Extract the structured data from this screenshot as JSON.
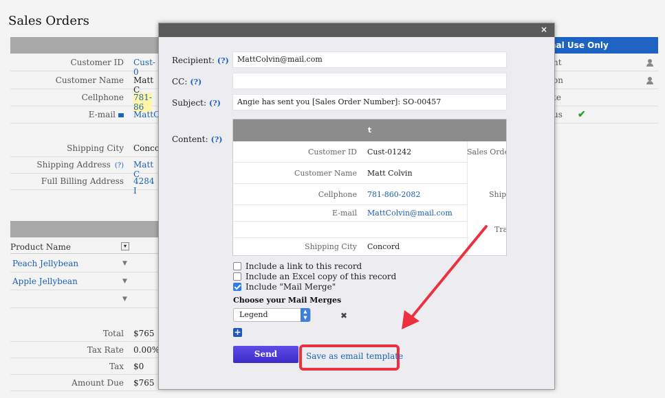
{
  "page": {
    "title": "Sales Orders",
    "internal_label": "nal Use Only"
  },
  "info_rows": [
    {
      "label": "Customer ID",
      "value": "Cust-0"
    },
    {
      "label": "Customer Name",
      "value": "Matt C"
    },
    {
      "label": "Cellphone",
      "value": "781-86"
    },
    {
      "label": "E-mail",
      "value": "MattC"
    }
  ],
  "shipping_rows": [
    {
      "label": "Shipping City",
      "value": "Concor"
    },
    {
      "label": "Shipping Address",
      "value": "Matt C"
    },
    {
      "label": "Full Billing Address",
      "value": "4284 I"
    }
  ],
  "right_rows": [
    "nt",
    "on",
    "te",
    "us"
  ],
  "products": {
    "header": "Product Name",
    "rows": [
      "Peach Jellybean",
      "Apple Jellybean",
      ""
    ]
  },
  "totals": [
    {
      "label": "Total",
      "value": "$765"
    },
    {
      "label": "Tax Rate",
      "value": "0.00%"
    },
    {
      "label": "Tax",
      "value": "$0"
    },
    {
      "label": "Amount Due",
      "value": "$765"
    }
  ],
  "modal": {
    "close": "×",
    "q": "(?)",
    "recipient_label": "Recipient:",
    "recipient_value": "MattColvin@mail.com",
    "cc_label": "CC:",
    "cc_value": "",
    "subject_label": "Subject:",
    "subject_value": "Angie has sent you [Sales Order Number]: SO-00457",
    "content_label": "Content:",
    "content": {
      "header": "t",
      "rows": [
        {
          "label": "Customer ID",
          "value": "Cust-01242",
          "side": "Sales Order"
        },
        {
          "label": "Customer Name",
          "value": "Matt Colvin",
          "side": ""
        },
        {
          "label": "Cellphone",
          "value": "781-860-2082",
          "side": "Shipp"
        },
        {
          "label": "E-mail",
          "value": "MattColvin@mail.com",
          "side": ""
        },
        {
          "label": "",
          "value": "",
          "side": "Tra"
        },
        {
          "label": "Shipping City",
          "value": "Concord",
          "side": ""
        }
      ]
    },
    "options": [
      {
        "label": "Include a link to this record",
        "checked": false
      },
      {
        "label": "Include an Excel copy of this record",
        "checked": false
      },
      {
        "label": "Include \"Mail Merge\"",
        "checked": true
      }
    ],
    "mail_merge_title": "Choose your Mail Merges",
    "mail_merge_selected": "Legend",
    "remove_icon": "✖",
    "add_icon": "+",
    "send_label": "Send",
    "save_template_label": "Save as email template"
  },
  "colors": {
    "accent_blue": "#1e63c4",
    "highlight_red": "#ec3040",
    "send_purple": "#4a38d8"
  }
}
